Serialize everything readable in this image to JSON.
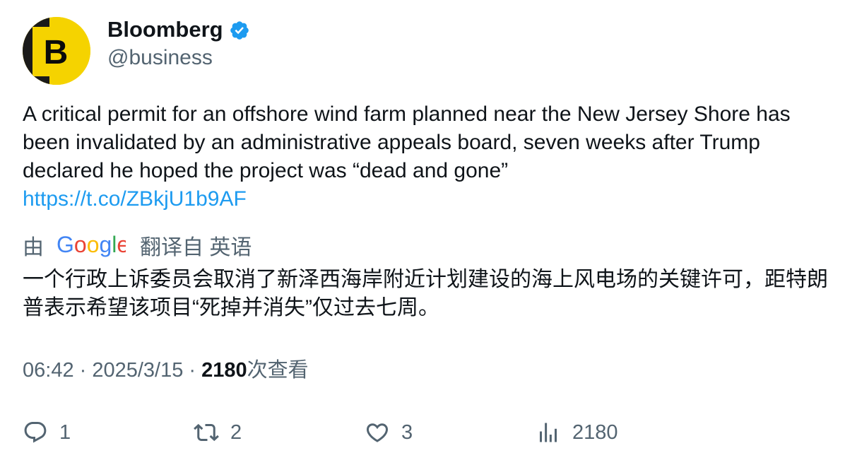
{
  "author": {
    "name": "Bloomberg",
    "handle": "@business",
    "avatar_letter": "B",
    "verified_color": "#1d9bf0"
  },
  "tweet": {
    "text": "A critical permit for an offshore wind farm planned near the New Jersey Shore has been invalidated by an administrative appeals board, seven weeks after Trump declared he hoped the project was “dead and gone”",
    "link": "https://t.co/ZBkjU1b9AF"
  },
  "translation": {
    "by": "由",
    "provider": "Google",
    "from_label": "翻译自 英语",
    "text": "一个行政上诉委员会取消了新泽西海岸附近计划建设的海上风电场的关键许可，距特朗普表示希望该项目“死掉并消失”仅过去七周。"
  },
  "meta": {
    "time": "06:42",
    "sep1": " · ",
    "date": "2025/3/15",
    "sep2": " · ",
    "views_count": "2180",
    "views_label": "次查看"
  },
  "actions": {
    "reply_count": "1",
    "retweet_count": "2",
    "like_count": "3",
    "views_count": "2180"
  },
  "colors": {
    "link": "#1d9bf0",
    "secondary_text": "#536471",
    "avatar_bg": "#f5d300"
  }
}
